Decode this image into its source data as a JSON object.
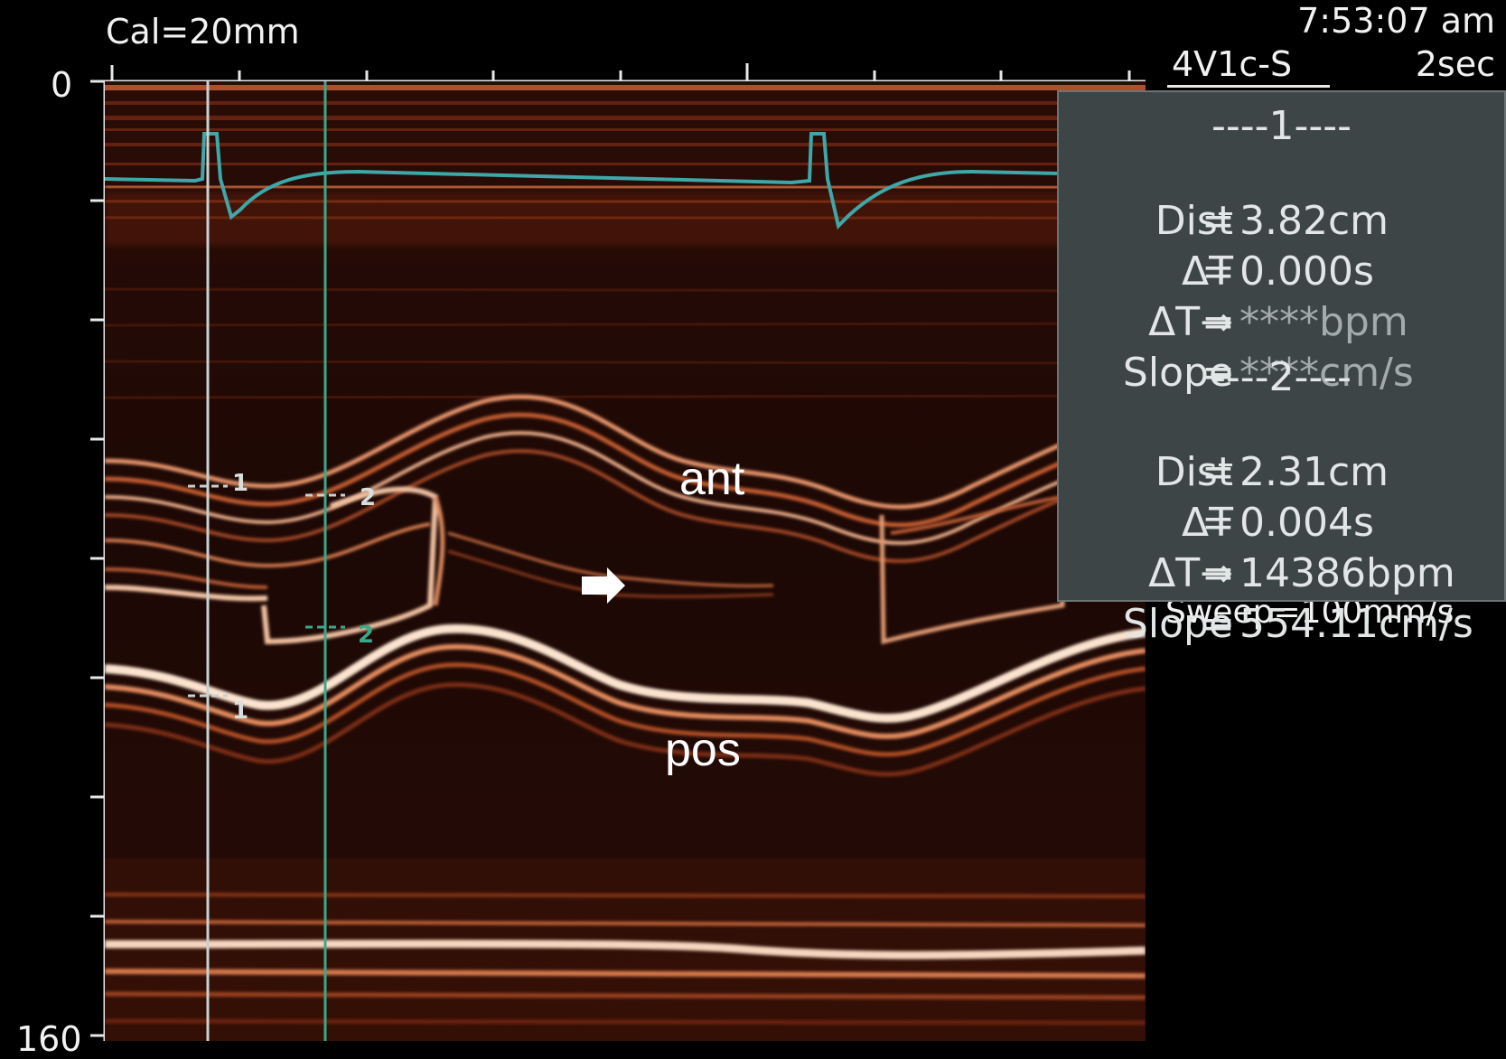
{
  "header": {
    "calibration": "Cal=20mm",
    "time": "7:53:07 am",
    "probe": "4V1c-S",
    "sweep_duration": "2sec",
    "sweep_speed": "Sweep=100mm/s"
  },
  "depth_axis": {
    "top_label": "0",
    "bottom_label": "160"
  },
  "measurements": [
    {
      "header": "----1----",
      "rows": [
        {
          "label": "Dist",
          "value": "3.82cm"
        },
        {
          "label": "ΔT",
          "value": "0.000s"
        },
        {
          "label": "ΔT→",
          "value": "****bpm"
        },
        {
          "label": "Slope",
          "value": "****cm/s"
        }
      ]
    },
    {
      "header": "----2----",
      "rows": [
        {
          "label": "Dist",
          "value": "2.31cm"
        },
        {
          "label": "ΔT",
          "value": "0.004s"
        },
        {
          "label": "ΔT→",
          "value": "14386bpm"
        },
        {
          "label": "Slope",
          "value": "554.11cm/s"
        }
      ]
    }
  ],
  "annotations": {
    "anterior": "ant",
    "posterior": "pos"
  },
  "cursor_markers": {
    "cursor1": "1",
    "cursor2": "2"
  },
  "colors": {
    "ecg_trace": "#3fa7a8",
    "cursor1": "#c9d2d2",
    "cursor2": "#3aa88a",
    "tissue": "#e07a45",
    "panel": "#3e4546"
  }
}
